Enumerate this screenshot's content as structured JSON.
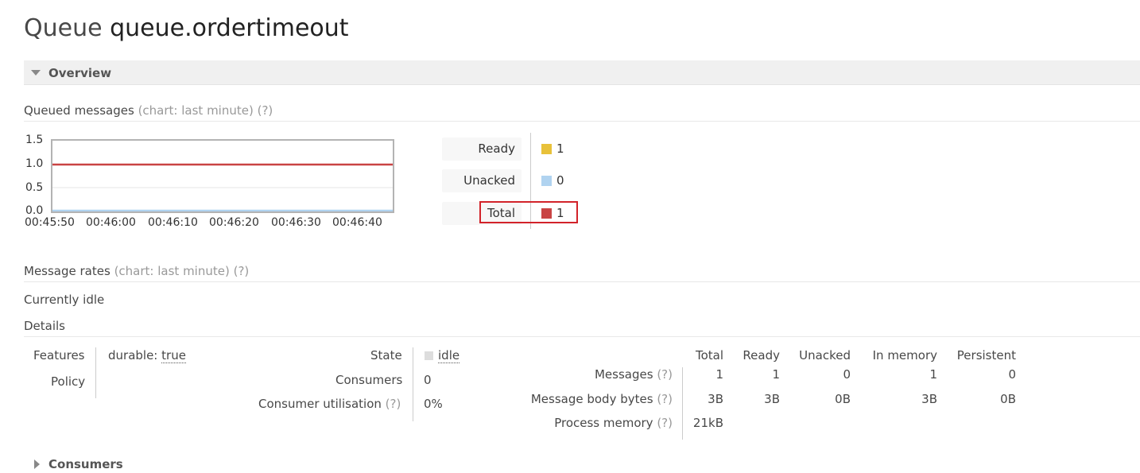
{
  "page": {
    "title_prefix": "Queue",
    "queue_name": "queue.ordertimeout"
  },
  "overview": {
    "label": "Overview"
  },
  "queued_messages": {
    "heading": "Queued messages",
    "chart_hint": "(chart: last minute)",
    "help": "(?)",
    "legend": [
      {
        "label": "Ready",
        "value": "1",
        "color": "#e8c13a"
      },
      {
        "label": "Unacked",
        "value": "0",
        "color": "#b0d3f0"
      },
      {
        "label": "Total",
        "value": "1",
        "color": "#c94444"
      }
    ]
  },
  "chart_data": {
    "type": "line",
    "x": [
      "00:45:50",
      "00:46:00",
      "00:46:10",
      "00:46:20",
      "00:46:30",
      "00:46:40"
    ],
    "y_ticks": [
      "1.5",
      "1.0",
      "0.5",
      "0.0"
    ],
    "ylim": [
      0,
      1.5
    ],
    "series": [
      {
        "name": "Total",
        "values": [
          1,
          1,
          1,
          1,
          1,
          1
        ],
        "color": "#c94444"
      },
      {
        "name": "Unacked",
        "values": [
          0,
          0,
          0,
          0,
          0,
          0
        ],
        "color": "#b0d3f0"
      }
    ]
  },
  "message_rates": {
    "heading": "Message rates",
    "chart_hint": "(chart: last minute)",
    "help": "(?)",
    "status": "Currently idle"
  },
  "details": {
    "heading": "Details",
    "features_label": "Features",
    "features_key": "durable:",
    "features_value": "true",
    "policy_label": "Policy",
    "state_label": "State",
    "state_value": "idle",
    "consumers_label": "Consumers",
    "consumers_value": "0",
    "utilisation_label": "Consumer utilisation",
    "utilisation_help": "(?)",
    "utilisation_value": "0%",
    "columns": [
      "Total",
      "Ready",
      "Unacked",
      "In memory",
      "Persistent"
    ],
    "rows": [
      {
        "label": "Messages",
        "help": "(?)",
        "values": [
          "1",
          "1",
          "0",
          "1",
          "0"
        ]
      },
      {
        "label": "Message body bytes",
        "help": "(?)",
        "values": [
          "3B",
          "3B",
          "0B",
          "3B",
          "0B"
        ]
      },
      {
        "label": "Process memory",
        "help": "(?)",
        "values": [
          "21kB"
        ]
      }
    ]
  },
  "consumers_section": {
    "label": "Consumers"
  }
}
